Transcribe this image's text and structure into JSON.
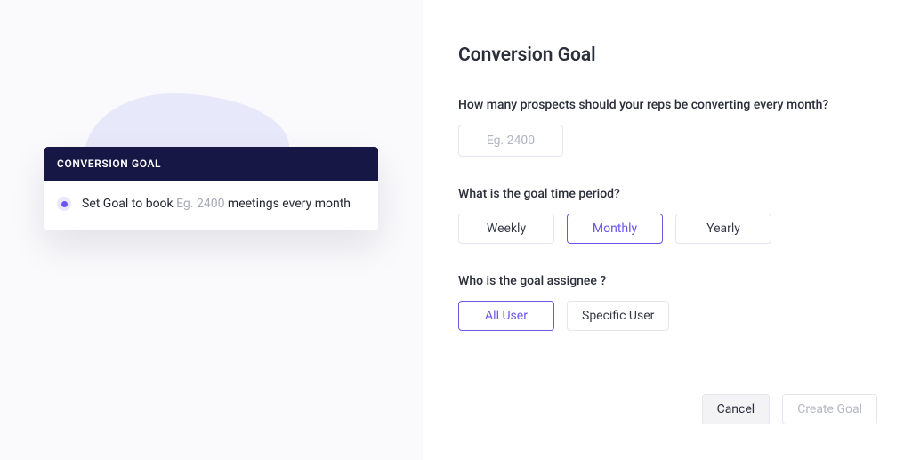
{
  "preview": {
    "header": "CONVERSION GOAL",
    "text_prefix": "Set Goal to book ",
    "placeholder": "Eg. 2400",
    "text_suffix": " meetings every month"
  },
  "form": {
    "title": "Conversion Goal",
    "q1_label": "How many prospects should your reps be converting every month?",
    "q1_placeholder": "Eg. 2400",
    "q2_label": "What is the goal time period?",
    "periods": {
      "weekly": "Weekly",
      "monthly": "Monthly",
      "yearly": "Yearly"
    },
    "selected_period": "monthly",
    "q3_label": "Who is the goal assignee ?",
    "assignees": {
      "all": "All User",
      "specific": "Specific User"
    },
    "selected_assignee": "all",
    "cancel": "Cancel",
    "create": "Create Goal"
  }
}
